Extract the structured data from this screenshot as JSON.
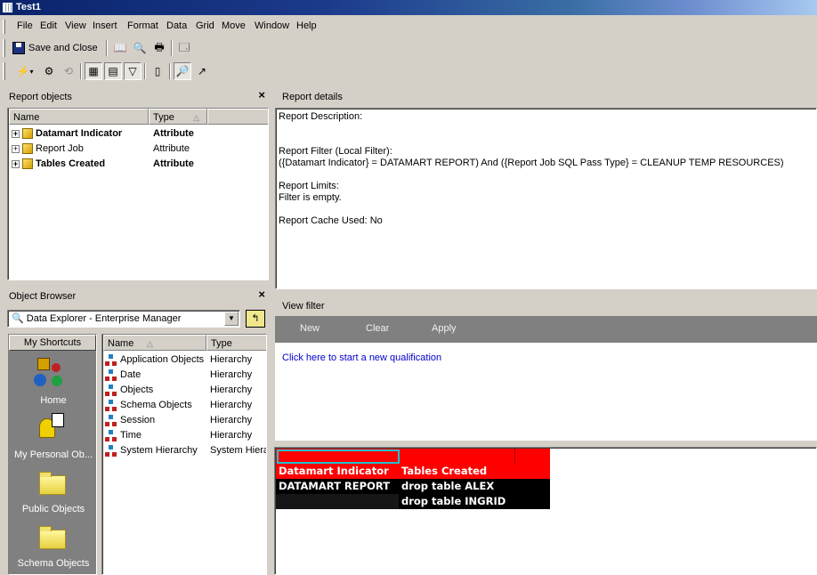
{
  "window": {
    "title": "Test1"
  },
  "menu": [
    "File",
    "Edit",
    "View",
    "Insert",
    "Format",
    "Data",
    "Grid",
    "Move",
    "Window",
    "Help"
  ],
  "toolbar1": {
    "save_close_label": "Save and Close"
  },
  "report_objects": {
    "title": "Report objects",
    "columns": {
      "name": "Name",
      "type": "Type"
    },
    "rows": [
      {
        "name": "Datamart Indicator",
        "type": "Attribute",
        "bold": true
      },
      {
        "name": "Report Job",
        "type": "Attribute",
        "bold": false
      },
      {
        "name": "Tables Created",
        "type": "Attribute",
        "bold": true
      }
    ]
  },
  "report_details": {
    "title": "Report details",
    "description_label": "Report Description:",
    "filter_label": "Report Filter (Local Filter):",
    "filter_value": "({Datamart Indicator} = DATAMART REPORT) And ({Report Job SQL Pass Type} = CLEANUP TEMP RESOURCES)",
    "limits_label": "Report Limits:",
    "limits_value": "Filter is empty.",
    "cache_label": "Report Cache Used: No"
  },
  "object_browser": {
    "title": "Object Browser",
    "source": "Data Explorer - Enterprise Manager",
    "shortcuts_tab": "My Shortcuts",
    "shortcuts": [
      "Home",
      "My Personal Ob...",
      "Public Objects",
      "Schema Objects"
    ],
    "columns": {
      "name": "Name",
      "type": "Type"
    },
    "rows": [
      {
        "name": "Application Objects",
        "type": "Hierarchy"
      },
      {
        "name": "Date",
        "type": "Hierarchy"
      },
      {
        "name": "Objects",
        "type": "Hierarchy"
      },
      {
        "name": "Schema Objects",
        "type": "Hierarchy"
      },
      {
        "name": "Session",
        "type": "Hierarchy"
      },
      {
        "name": "Time",
        "type": "Hierarchy"
      },
      {
        "name": "System Hierarchy",
        "type": "System Hiera"
      }
    ]
  },
  "view_filter": {
    "title": "View filter",
    "buttons": {
      "new": "New",
      "clear": "Clear",
      "apply": "Apply"
    },
    "link": "Click here to start a new qualification"
  },
  "grid": {
    "headers": [
      "Datamart Indicator",
      "Tables Created"
    ],
    "rows": [
      [
        "DATAMART REPORT",
        "drop table ALEX"
      ],
      [
        "",
        "drop table INGRID"
      ]
    ],
    "header_color": "#ff0000"
  }
}
